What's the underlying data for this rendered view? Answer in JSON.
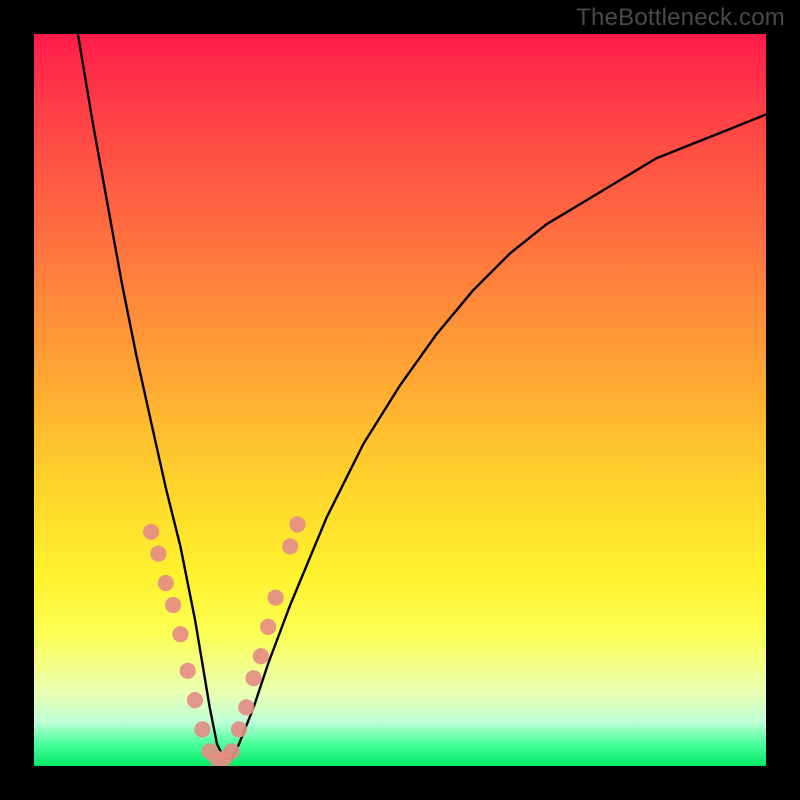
{
  "watermark": "TheBottleneck.com",
  "chart_data": {
    "type": "line",
    "title": "",
    "xlabel": "",
    "ylabel": "",
    "xlim": [
      0,
      100
    ],
    "ylim": [
      0,
      100
    ],
    "grid": false,
    "legend": false,
    "background_gradient": {
      "direction": "vertical",
      "stops": [
        {
          "pos": 0.0,
          "color": "#ff1c4b"
        },
        {
          "pos": 0.28,
          "color": "#ff703f"
        },
        {
          "pos": 0.62,
          "color": "#ffd52b"
        },
        {
          "pos": 0.82,
          "color": "#fcff54"
        },
        {
          "pos": 0.94,
          "color": "#bcffd6"
        },
        {
          "pos": 1.0,
          "color": "#00e865"
        }
      ]
    },
    "series": [
      {
        "name": "bottleneck-curve",
        "color": "#000000",
        "x": [
          6,
          8,
          10,
          12,
          14,
          16,
          18,
          20,
          22,
          23,
          24,
          25,
          26,
          27,
          28,
          30,
          32,
          35,
          40,
          45,
          50,
          55,
          60,
          65,
          70,
          75,
          80,
          85,
          90,
          95,
          100
        ],
        "values": [
          100,
          88,
          77,
          66,
          56,
          47,
          38,
          30,
          20,
          14,
          8,
          3,
          1,
          1,
          3,
          8,
          14,
          22,
          34,
          44,
          52,
          59,
          65,
          70,
          74,
          77,
          80,
          83,
          85,
          87,
          89
        ]
      }
    ],
    "markers": [
      {
        "name": "dot-cluster",
        "color": "#e48d86",
        "radius_pct": 1.1,
        "points": [
          {
            "x": 16,
            "y": 32
          },
          {
            "x": 17,
            "y": 29
          },
          {
            "x": 18,
            "y": 25
          },
          {
            "x": 19,
            "y": 22
          },
          {
            "x": 20,
            "y": 18
          },
          {
            "x": 21,
            "y": 13
          },
          {
            "x": 22,
            "y": 9
          },
          {
            "x": 23,
            "y": 5
          },
          {
            "x": 24,
            "y": 2
          },
          {
            "x": 25,
            "y": 1
          },
          {
            "x": 26,
            "y": 1
          },
          {
            "x": 27,
            "y": 2
          },
          {
            "x": 28,
            "y": 5
          },
          {
            "x": 29,
            "y": 8
          },
          {
            "x": 30,
            "y": 12
          },
          {
            "x": 31,
            "y": 15
          },
          {
            "x": 32,
            "y": 19
          },
          {
            "x": 33,
            "y": 23
          },
          {
            "x": 35,
            "y": 30
          },
          {
            "x": 36,
            "y": 33
          }
        ]
      }
    ]
  }
}
